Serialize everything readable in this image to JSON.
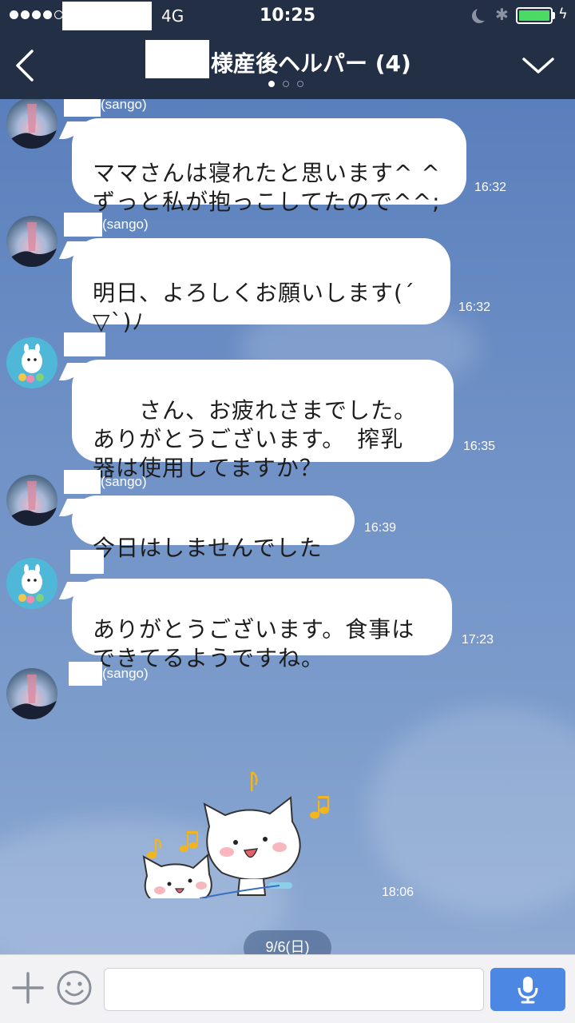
{
  "status_bar": {
    "network": "4G",
    "time": "10:25",
    "battery_level": 1.0
  },
  "header": {
    "title": "様産後ヘルパー (4)",
    "page_indicator": {
      "count": 3,
      "active": 0
    },
    "back_icon": "chevron-left-icon",
    "menu_icon": "chevron-down-icon"
  },
  "messages": [
    {
      "sender_suffix": "(sango)",
      "text": "ママさんは寝れたと思います^ ^\nずっと私が抱っこしてたので^^;",
      "time": "16:32"
    },
    {
      "sender_suffix": "(sango)",
      "text": "明日、よろしくお願いします(´\n▽`)ﾉ",
      "time": "16:32"
    },
    {
      "sender_suffix": "",
      "text": "さん、お疲れさまでした。\nありがとうございます。　搾乳\n器は使用してますか？",
      "time": "16:35"
    },
    {
      "sender_suffix": "(sango)",
      "text": "今日はしませんでした",
      "time": "16:39"
    },
    {
      "sender_suffix": "",
      "text": "ありがとうございます。食事は\nできてるようですね。",
      "time": "17:23"
    },
    {
      "sender_suffix": "(sango)",
      "sticker": "cats-music-sticker",
      "time": "18:06"
    }
  ],
  "date_divider": "9/6(日)",
  "input_bar": {
    "placeholder": "",
    "plus_icon": "plus-icon",
    "emoji_icon": "smiley-icon",
    "mic_icon": "microphone-icon"
  },
  "colors": {
    "header_bg": "#232f45",
    "chat_bg": "#6d8fc0",
    "bubble_bg": "#ffffff",
    "mic_button": "#4b87e3",
    "battery": "#4cd964"
  }
}
